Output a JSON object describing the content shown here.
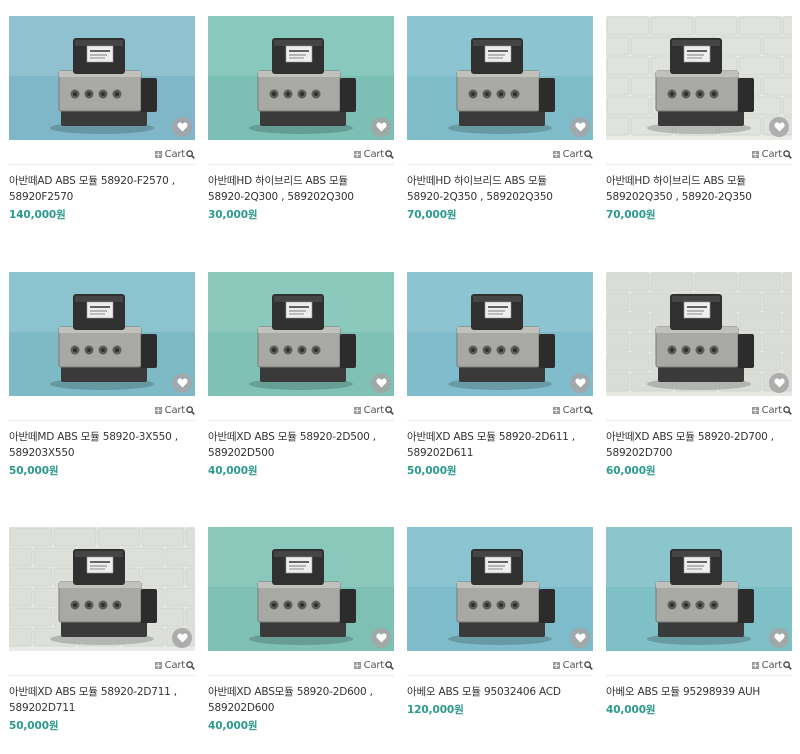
{
  "labels": {
    "cart": "Cart"
  },
  "products": [
    {
      "line1": "아반떼AD ABS 모듈 58920-F2570 ,",
      "line2": "58920F2570",
      "price": "140,000원",
      "bg": "#7fb7c8",
      "bg2": "#8fc1d1",
      "wall": false
    },
    {
      "line1": "아반떼HD 하이브리드 ABS 모듈",
      "line2": "58920-2Q300 , 589202Q300",
      "price": "30,000원",
      "bg": "#7cc0b5",
      "bg2": "#88c8bd",
      "wall": false
    },
    {
      "line1": "아반떼HD 하이브리드 ABS 모듈",
      "line2": "58920-2Q350 , 589202Q350",
      "price": "70,000원",
      "bg": "#7fbcc9",
      "bg2": "#8cc5d1",
      "wall": false
    },
    {
      "line1": "아반떼HD 하이브리드 ABS 모듈",
      "line2": "589202Q350 , 58920-2Q350",
      "price": "70,000원",
      "bg": "#e9ebe7",
      "bg2": "#dfe2dd",
      "wall": true
    },
    {
      "line1": "아반떼MD ABS 모듈 58920-3X550 ,",
      "line2": "589203X550",
      "price": "50,000원",
      "bg": "#7dbac6",
      "bg2": "#8bc3ce",
      "wall": false
    },
    {
      "line1": "아반떼XD ABS 모듈 58920-2D500 ,",
      "line2": "589202D500",
      "price": "40,000원",
      "bg": "#7fc2b5",
      "bg2": "#8bc9bd",
      "wall": false
    },
    {
      "line1": "아반떼XD ABS 모듈 58920-2D611 ,",
      "line2": "589202D611",
      "price": "50,000원",
      "bg": "#80bccb",
      "bg2": "#8cc4d1",
      "wall": false
    },
    {
      "line1": "아반떼XD ABS 모듈 58920-2D700 ,",
      "line2": "589202D700",
      "price": "60,000원",
      "bg": "#e6e8e4",
      "bg2": "#dadcd8",
      "wall": true
    },
    {
      "line1": "아반떼XD ABS 모듈 58920-2D711 ,",
      "line2": "589202D711",
      "price": "50,000원",
      "bg": "#e8eae6",
      "bg2": "#dcdfda",
      "wall": true
    },
    {
      "line1": "아반떼XD ABS모듈 58920-2D600 ,",
      "line2": "589202D600",
      "price": "40,000원",
      "bg": "#7ec0b3",
      "bg2": "#8ac8bc",
      "wall": false
    },
    {
      "line1": "아베오 ABS 모듈 95032406 ACD",
      "line2": "",
      "price": "120,000원",
      "bg": "#7fbccb",
      "bg2": "#8bc4d1",
      "wall": false
    },
    {
      "line1": "아베오 ABS 모듈 95298939 AUH",
      "line2": "",
      "price": "40,000원",
      "bg": "#7fbfc6",
      "bg2": "#8bc6cd",
      "wall": false
    }
  ]
}
